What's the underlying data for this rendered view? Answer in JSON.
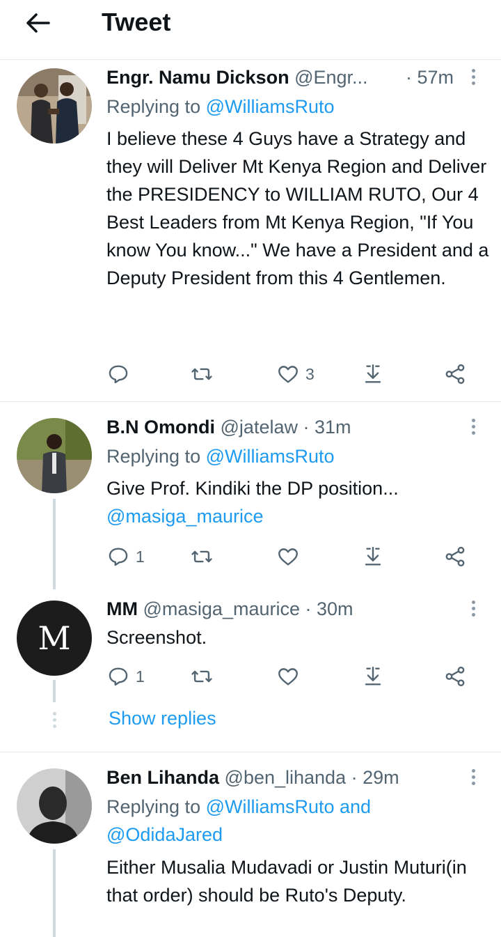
{
  "header": {
    "title": "Tweet",
    "back_icon": "arrow-left-icon"
  },
  "colors": {
    "link": "#1d9bf0",
    "meta": "#536471",
    "text": "#0f1419",
    "divider": "#e6e9eb"
  },
  "tweets": [
    {
      "name": "Engr. Namu Dickson",
      "handle": "@Engr...",
      "time": "· 57m",
      "replying_prefix": "Replying to ",
      "replying_to": "@WilliamsRuto",
      "text": "I believe these 4 Guys have a Strategy and they will Deliver Mt Kenya Region and Deliver the PRESIDENCY to WILLIAM RUTO, Our 4 Best Leaders from Mt Kenya Region, \"If You know You know...\" We have a President and a Deputy President from this 4 Gentlemen.",
      "reply_count": "",
      "retweet_count": "",
      "like_count": "3"
    },
    {
      "name": "B.N Omondi",
      "handle": "@jatelaw",
      "time": "· 31m",
      "replying_prefix": "Replying to ",
      "replying_to": "@WilliamsRuto",
      "text": "Give Prof. Kindiki the DP position...",
      "mention": "@masiga_maurice",
      "reply_count": "1",
      "retweet_count": "",
      "like_count": ""
    },
    {
      "name": "MM",
      "handle": "@masiga_maurice",
      "time": "· 30m",
      "avatar_letter": "M",
      "text": "Screenshot.",
      "reply_count": "1",
      "retweet_count": "",
      "like_count": ""
    },
    {
      "name": "Ben Lihanda",
      "handle": "@ben_lihanda",
      "time": "· 29m",
      "replying_prefix": "Replying to ",
      "replying_to": "@WilliamsRuto and",
      "replying_to_2": "@OdidaJared",
      "text": "Either Musalia Mudavadi or Justin Muturi(in that order) should be Ruto's Deputy."
    }
  ],
  "show_replies": "Show replies",
  "icons": [
    "reply-icon",
    "retweet-icon",
    "like-icon",
    "share-icon",
    "more-icon"
  ]
}
